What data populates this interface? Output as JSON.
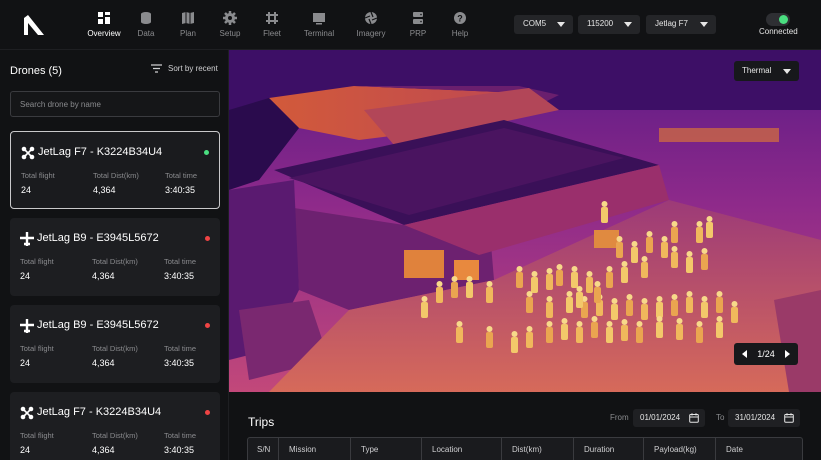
{
  "nav": {
    "items": [
      {
        "label": "Overview",
        "icon": "grid-icon",
        "active": true
      },
      {
        "label": "Data",
        "icon": "database-icon"
      },
      {
        "label": "Plan",
        "icon": "map-icon"
      },
      {
        "label": "Setup",
        "icon": "gear-icon"
      },
      {
        "label": "Fleet",
        "icon": "drone-icon"
      },
      {
        "label": "Terminal",
        "icon": "terminal-icon"
      },
      {
        "label": "Imagery",
        "icon": "aperture-icon"
      },
      {
        "label": "PRP",
        "icon": "server-icon"
      },
      {
        "label": "Help",
        "icon": "help-icon"
      }
    ],
    "port": "COM5",
    "baud": "115200",
    "device": "Jetlag F7",
    "status": "Connected"
  },
  "sidebar": {
    "title": "Drones (5)",
    "sort_label": "Sort by recent",
    "search_placeholder": "Search drone by name",
    "stat_labels": {
      "flight": "Total flight",
      "dist": "Total Dist(km)",
      "time": "Total time"
    },
    "drones": [
      {
        "name": "JetLag F7 - K3224B34U4",
        "type": "quad",
        "status_color": "#4ade80",
        "flight": "24",
        "dist": "4,364",
        "time": "3:40:35",
        "selected": true
      },
      {
        "name": "JetLag B9 - E3945L5672",
        "type": "plus",
        "status_color": "#ef4444",
        "flight": "24",
        "dist": "4,364",
        "time": "3:40:35"
      },
      {
        "name": "JetLag B9 - E3945L5672",
        "type": "plus",
        "status_color": "#ef4444",
        "flight": "24",
        "dist": "4,364",
        "time": "3:40:35"
      },
      {
        "name": "JetLag F7 - K3224B34U4",
        "type": "quad",
        "status_color": "#ef4444",
        "flight": "24",
        "dist": "4,364",
        "time": "3:40:35"
      }
    ]
  },
  "view": {
    "mode": "Thermal",
    "page": "1/24"
  },
  "trips": {
    "title": "Trips",
    "from_label": "From",
    "from_date": "01/01/2024",
    "to_label": "To",
    "to_date": "31/01/2024",
    "columns": [
      "S/N",
      "Mission",
      "Type",
      "Location",
      "Dist(km)",
      "Duration",
      "Payload(kg)",
      "Date"
    ]
  }
}
